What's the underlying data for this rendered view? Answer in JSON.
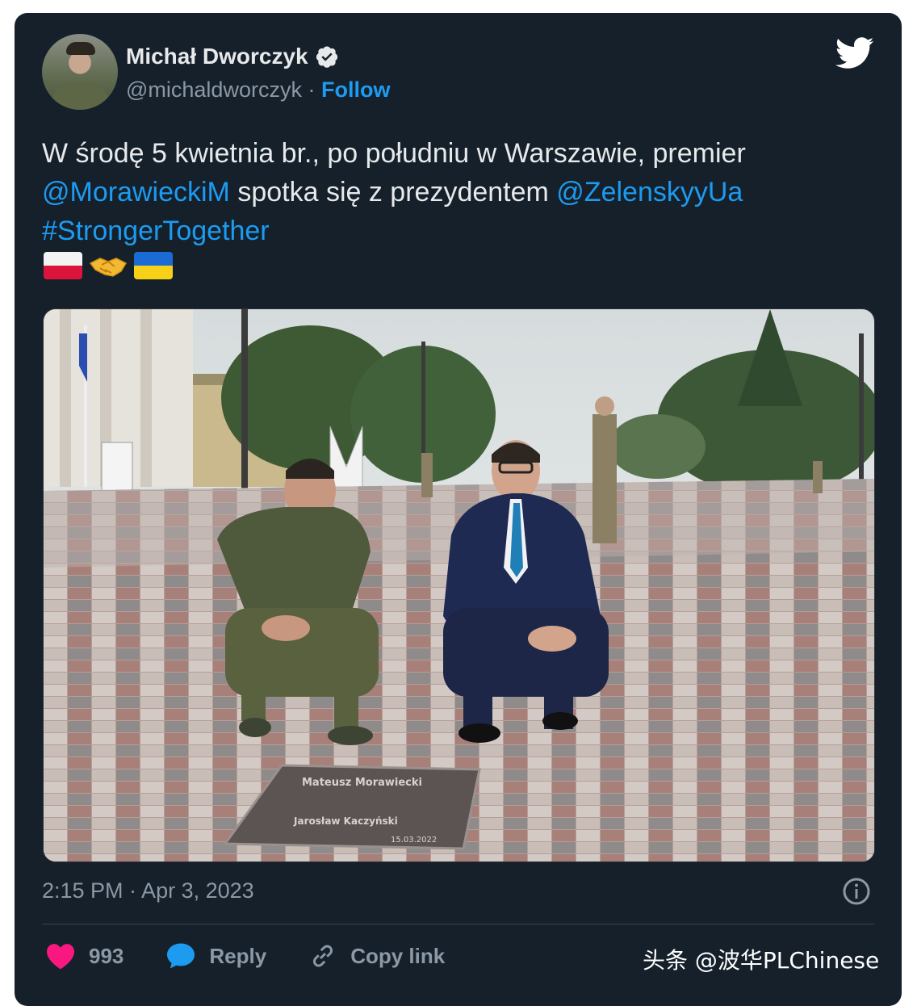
{
  "author": {
    "name": "Michał Dworczyk",
    "handle": "@michaldworczyk",
    "separator": "·",
    "follow_label": "Follow"
  },
  "tweet": {
    "text_part1": "W środę 5 kwietnia br., po południu w Warszawie, premier",
    "mention1": "@MorawieckiM",
    "text_part2": " spotka się z prezydentem ",
    "mention2": "@ZelenskyyUa",
    "hashtag": "#StrongerTogether",
    "emojis": [
      "flag-poland",
      "handshake",
      "flag-ukraine"
    ]
  },
  "photo": {
    "plaque_name": "Mateusz Morawiecki",
    "plaque_sub": "Jarosław Kaczyński",
    "plaque_date": "15.03.2022"
  },
  "meta": {
    "timestamp": "2:15 PM · Apr 3, 2023"
  },
  "actions": {
    "like_count": "993",
    "reply_label": "Reply",
    "copy_label": "Copy link"
  },
  "watermark": "头条 @波华PLChinese",
  "colors": {
    "background": "#15202b",
    "text": "#e7e9ea",
    "muted": "#8b98a5",
    "accent": "#1d9bf0",
    "like": "#f91880"
  }
}
